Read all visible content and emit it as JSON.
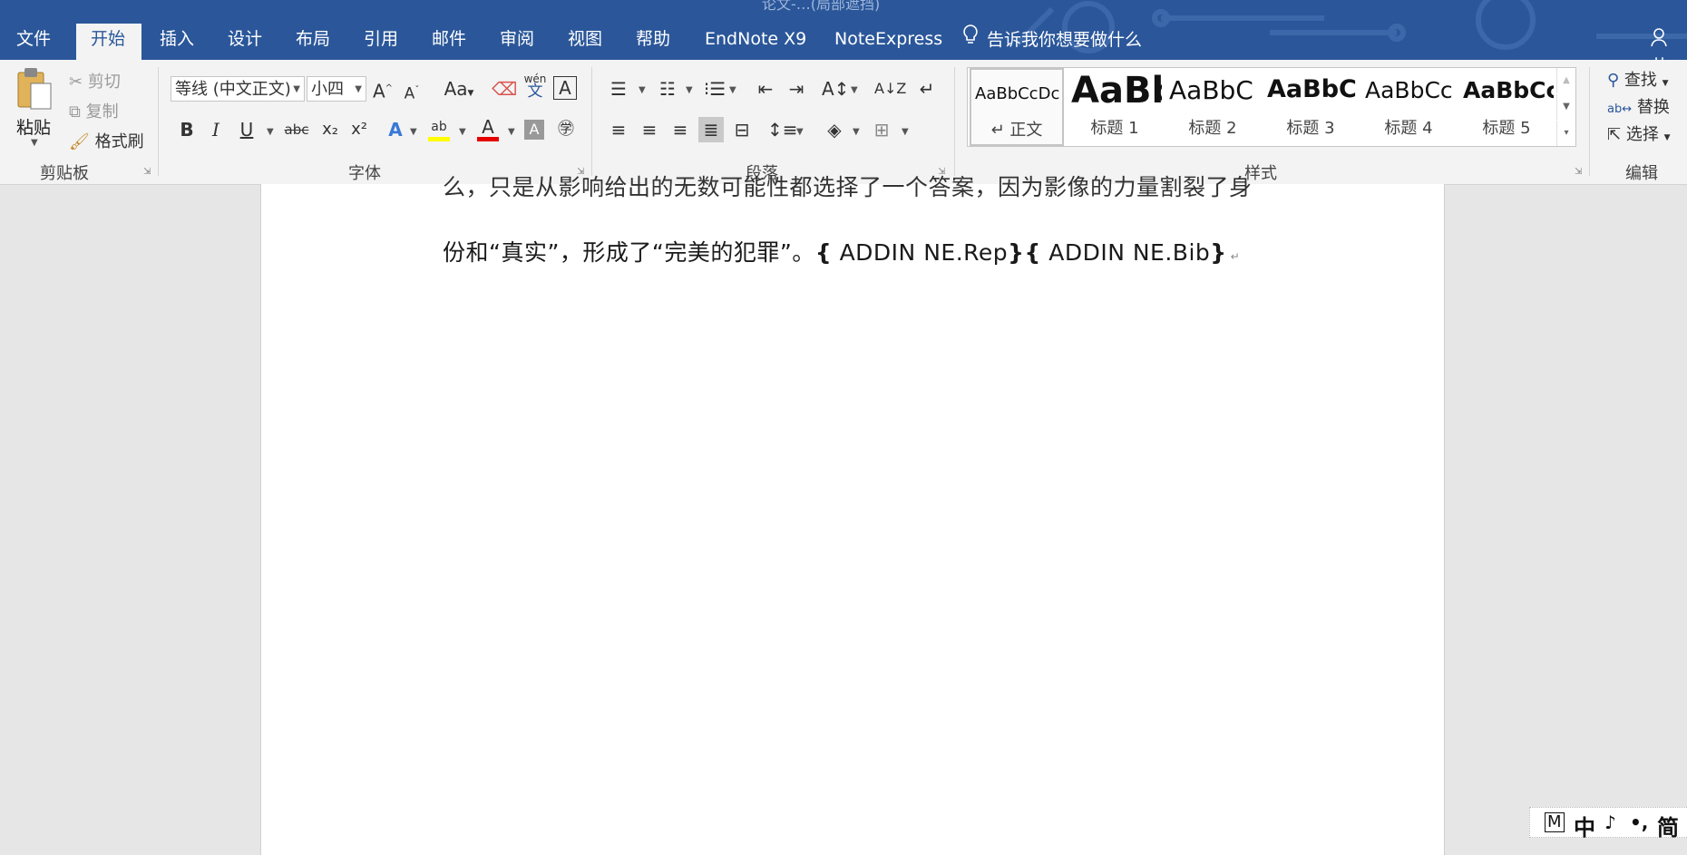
{
  "window": {
    "title": "论文-…(局部遮挡)"
  },
  "menu": {
    "tabs": [
      "文件",
      "开始",
      "插入",
      "设计",
      "布局",
      "引用",
      "邮件",
      "审阅",
      "视图",
      "帮助",
      "EndNote X9",
      "NoteExpress"
    ],
    "active": "开始",
    "tell_me": "告诉我你想要做什么",
    "share_partial": "共"
  },
  "ribbon": {
    "clipboard": {
      "label": "剪贴板",
      "paste": "粘贴",
      "cut": "剪切",
      "copy": "复制",
      "format_painter": "格式刷"
    },
    "font": {
      "label": "字体",
      "font_name": "等线 (中文正文)",
      "font_size": "小四",
      "grow": "A",
      "shrink": "A",
      "change_case": "Aa",
      "phonetic": "wén",
      "phonetic_char": "文",
      "bold": "B",
      "italic": "I",
      "underline": "U",
      "strike": "abc",
      "subscript": "x₂",
      "superscript": "x²",
      "highlight_color": "#ffff00",
      "font_color": "#e60000"
    },
    "paragraph": {
      "label": "段落"
    },
    "styles": {
      "label": "样式",
      "items": [
        {
          "sample": "AaBbCcDc",
          "name": "正文"
        },
        {
          "sample": "AaBb",
          "name": "标题 1"
        },
        {
          "sample": "AaBbC",
          "name": "标题 2"
        },
        {
          "sample": "AaBbC",
          "name": "标题 3"
        },
        {
          "sample": "AaBbCc",
          "name": "标题 4"
        },
        {
          "sample": "AaBbCc",
          "name": "标题 5"
        }
      ]
    },
    "editing": {
      "label": "编辑",
      "find": "查找",
      "replace": "替换",
      "select": "选择"
    }
  },
  "document": {
    "line_top": "么，只是从影响给出的无数可能性都选择了一个答案，因为影像的力量割裂了身",
    "line_main": "份和“真实”，形成了“完美的犯罪”。",
    "field1": "ADDIN NE.Rep",
    "field2": "ADDIN NE.Bib"
  },
  "ime": {
    "mode": "M",
    "lang": "中",
    "moon": "♪",
    "punct": "•,",
    "script": "简"
  }
}
